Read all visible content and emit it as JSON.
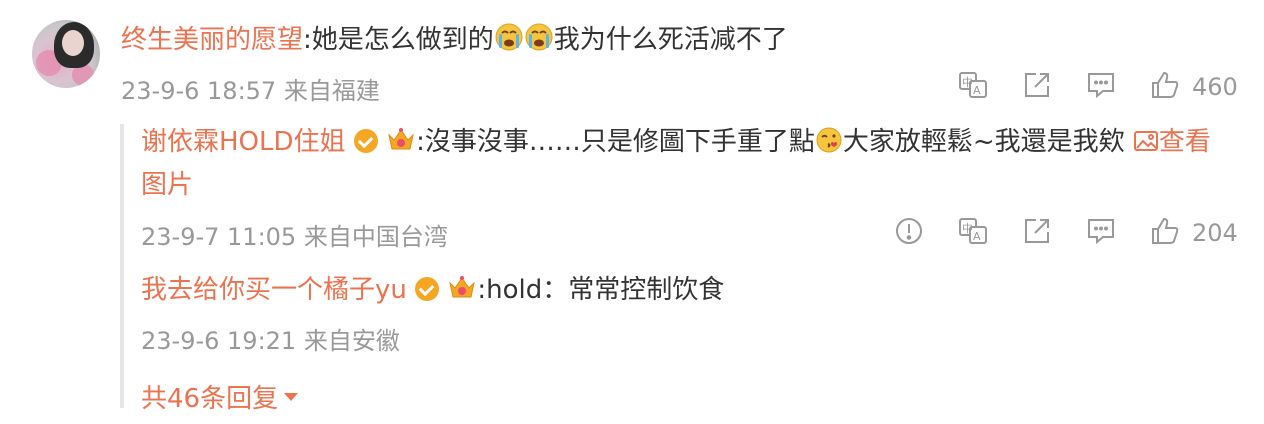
{
  "comment": {
    "author": "终生美丽的愿望",
    "text_pre": ":她是怎么做到的",
    "text_post": "我为什么死活减不了",
    "timestamp": "23-9-6 18:57",
    "location": "来自福建",
    "like_count": "460"
  },
  "replies": [
    {
      "author": "谢依霖HOLD住姐",
      "text_pre": ":沒事沒事……只是修圖下手重了點",
      "text_post": "大家放輕鬆~我還是我欸",
      "image_link_line1": "查看",
      "image_link_line2": "图片",
      "timestamp": "23-9-7 11:05",
      "location": "来自中国台湾",
      "like_count": "204"
    },
    {
      "author": "我去给你买一个橘子yu",
      "text": ":hold：常常控制饮食",
      "timestamp": "23-9-6 19:21",
      "location": "来自安徽"
    }
  ],
  "more_replies_label": "共46条回复",
  "colors": {
    "accent": "#eb7350",
    "meta": "#999999",
    "text": "#333333",
    "badge": "#f5a623"
  },
  "icons": [
    "translate-icon",
    "share-icon",
    "comment-icon",
    "like-icon",
    "report-icon",
    "image-icon",
    "verified-badge-icon",
    "crown-icon",
    "crying-emoji-icon",
    "kiss-emoji-icon",
    "caret-down-icon"
  ]
}
